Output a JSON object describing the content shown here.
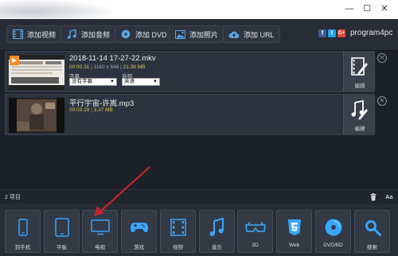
{
  "window": {
    "minimize": "—",
    "maximize": "☐",
    "close": "✕"
  },
  "toolbar": {
    "add_video": "添加视频",
    "add_audio": "添加音频",
    "add_dvd": "添加 DVD",
    "add_photo": "添加照片",
    "add_url": "添加 URL",
    "social": [
      "f",
      "t",
      "G+"
    ],
    "logo": "program4pc"
  },
  "files": [
    {
      "name": "2018-11-14 17-27-22.mkv",
      "duration": "00:00:31",
      "resolution": "1160 x 646",
      "size": "21.38 MB",
      "subtitle_label": "字幕",
      "subtitle_value": "没有字幕",
      "audio_label": "音频",
      "audio_value": "英语",
      "edit_label": "编辑"
    },
    {
      "name": "平行宇宙-许嵩.mp3",
      "duration": "00:03:29",
      "size": "3.37 MB",
      "edit_label": "编辑"
    }
  ],
  "status": {
    "count": "2 项目",
    "font_label": "Aa"
  },
  "devices": [
    {
      "label": "到手机",
      "icon": "phone-icon"
    },
    {
      "label": "平板",
      "icon": "tablet-icon"
    },
    {
      "label": "电视",
      "icon": "tv-icon"
    },
    {
      "label": "游戏",
      "icon": "gamepad-icon"
    },
    {
      "label": "视频",
      "icon": "film-icon"
    },
    {
      "label": "音乐",
      "icon": "music-icon"
    },
    {
      "label": "3D",
      "icon": "3d-glasses-icon"
    },
    {
      "label": "Web",
      "icon": "html5-icon"
    },
    {
      "label": "DVD/BD",
      "icon": "disc-icon"
    },
    {
      "label": "搜索",
      "icon": "search-icon"
    }
  ],
  "colors": {
    "accent_arrow": "#c0262a",
    "meta_yellow": "#d7c455",
    "facebook": "#3b5998",
    "twitter": "#1da1f2",
    "google": "#dd4b39"
  }
}
